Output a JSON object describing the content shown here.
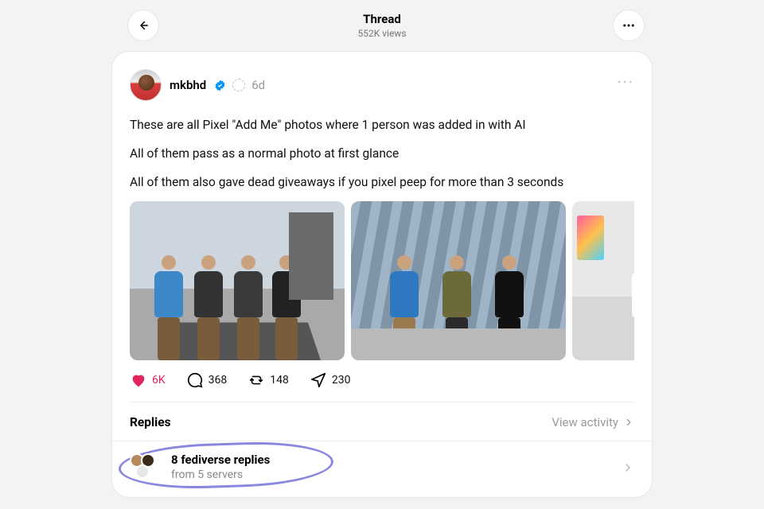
{
  "header": {
    "title": "Thread",
    "views": "552K views"
  },
  "post": {
    "username": "mkbhd",
    "age": "6d",
    "paragraphs": [
      "These are all Pixel \"Add Me\" photos where 1 person was added in with AI",
      "All of them pass as a normal photo at first glance",
      "All of them also gave dead giveaways if you pixel peep for more than 3 seconds"
    ],
    "counts": {
      "likes": "6K",
      "replies": "368",
      "reposts": "148",
      "shares": "230"
    }
  },
  "replies": {
    "label": "Replies",
    "view_activity": "View activity"
  },
  "fediverse": {
    "title": "8 fediverse replies",
    "subtitle": "from 5 servers"
  }
}
